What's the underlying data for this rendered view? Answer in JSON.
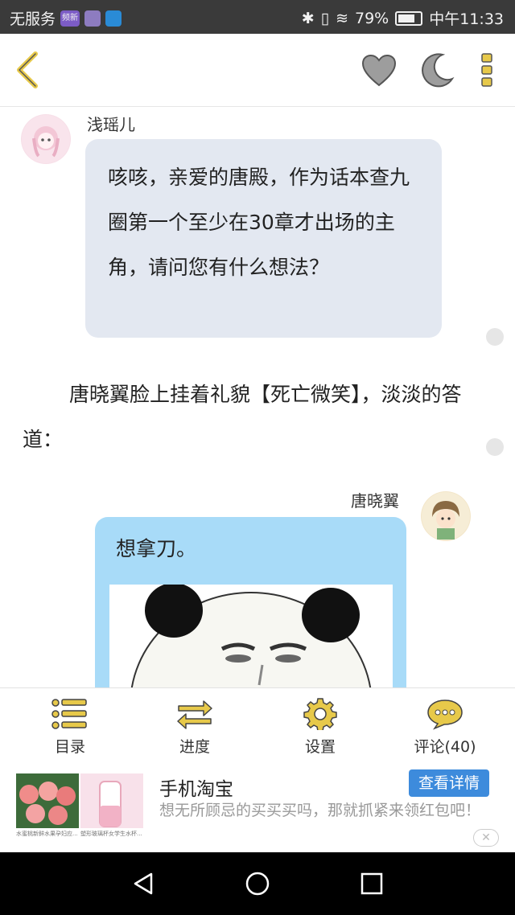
{
  "status_bar": {
    "carrier": "无服务",
    "badge_text": "频新",
    "battery": "79%",
    "time": "中午11:33"
  },
  "toolbar_top": {
    "icons": [
      "back-icon",
      "heart-icon",
      "moon-icon",
      "more-vertical-icon"
    ],
    "accent_color": "#e7c94a"
  },
  "chat": {
    "msg1": {
      "speaker": "浅瑶儿",
      "text": "咳咳，亲爱的唐殿，作为话本查九圈第一个至少在30章才出场的主角，请问您有什么想法？"
    },
    "narration": "唐晓翼脸上挂着礼貌【死亡微笑】，淡淡的答道：",
    "msg2": {
      "speaker": "唐晓翼",
      "text": "想拿刀。"
    }
  },
  "bottom_toolbar": {
    "catalog": "目录",
    "progress": "进度",
    "settings": "设置",
    "comments": "评论(40)"
  },
  "ad": {
    "title": "手机淘宝",
    "button": "查看详情",
    "desc": "想无所顾忌的买买买吗，那就抓紧来领红包吧！",
    "img1_caption": "水蜜桃新鲜水果孕妇应...",
    "img2_caption": "塑形玻璃杯女学生水杯...",
    "close": "✕"
  }
}
